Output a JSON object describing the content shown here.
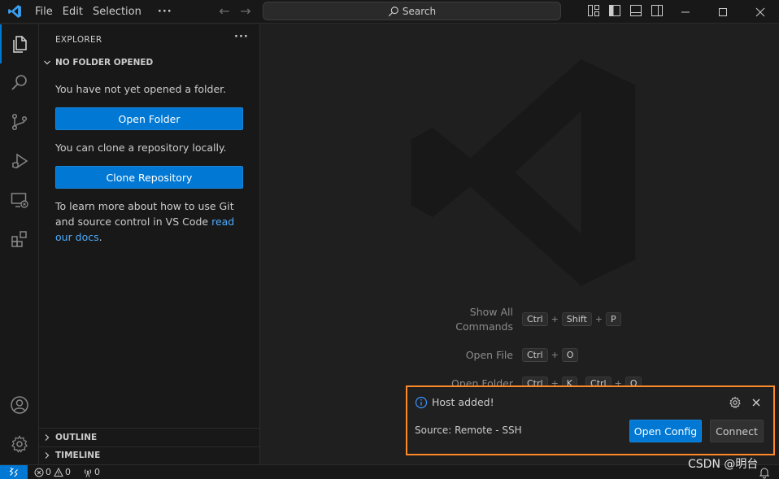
{
  "menu": {
    "file": "File",
    "edit": "Edit",
    "selection": "Selection",
    "more": "···"
  },
  "search": {
    "label": "Search"
  },
  "sidebar": {
    "title": "EXPLORER",
    "more": "···",
    "section": "NO FOLDER OPENED",
    "no_folder_text": "You have not yet opened a folder.",
    "open_folder": "Open Folder",
    "clone_text": "You can clone a repository locally.",
    "clone_repo": "Clone Repository",
    "learn_text": "To learn more about how to use Git and source control in VS Code ",
    "learn_link": "read our docs",
    "learn_end": ".",
    "outline": "OUTLINE",
    "timeline": "TIMELINE"
  },
  "shortcuts": {
    "show_all_1": "Show All",
    "show_all_2": "Commands",
    "open_file": "Open File",
    "open_folder": "Open Folder",
    "key_ctrl": "Ctrl",
    "key_shift": "Shift",
    "key_p": "P",
    "key_o": "O",
    "key_k": "K",
    "plus": "+"
  },
  "notification": {
    "message": "Host added!",
    "source": "Source: Remote - SSH",
    "open_config": "Open Config",
    "connect": "Connect"
  },
  "status": {
    "errors": "0",
    "warnings": "0",
    "ports": "0"
  },
  "watermark_credit": "CSDN @明台",
  "colors": {
    "accent": "#0078d4",
    "highlight_border": "#ff8a2a",
    "link": "#4daafc"
  }
}
